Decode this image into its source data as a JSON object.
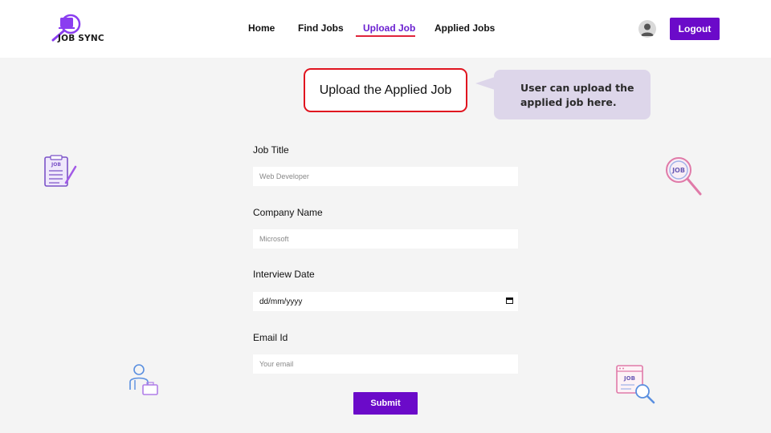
{
  "brand": {
    "name": "JOB SYNC"
  },
  "nav": {
    "items": [
      {
        "label": "Home"
      },
      {
        "label": "Find Jobs"
      },
      {
        "label": "Upload Job"
      },
      {
        "label": "Applied Jobs"
      }
    ],
    "active": "Upload Job"
  },
  "header": {
    "logout_label": "Logout",
    "avatar_icon": "user-avatar-icon"
  },
  "page": {
    "heading": "Upload the Applied Job",
    "callout_line1": "User can upload the",
    "callout_line2": "applied job here."
  },
  "form": {
    "job_title": {
      "label": "Job Title",
      "placeholder": "Web Developer"
    },
    "company_name": {
      "label": "Company Name",
      "placeholder": "Microsoft"
    },
    "interview_date": {
      "label": "Interview Date",
      "placeholder": "dd/mm/yyyy"
    },
    "email": {
      "label": "Email Id",
      "placeholder": "Your email"
    },
    "submit_label": "Submit"
  },
  "colors": {
    "accent": "#6b0ac9",
    "active_nav": "#6a1fd0",
    "highlight": "#e0141f",
    "callout_bg": "#ddd6ea"
  }
}
